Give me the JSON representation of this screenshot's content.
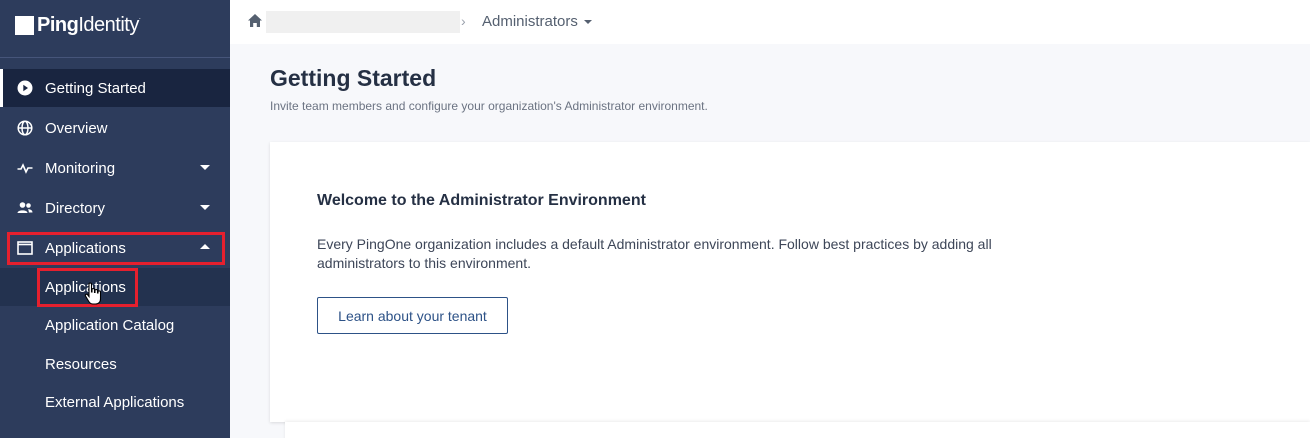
{
  "brand": {
    "logo_bold": "Ping",
    "logo_light": "Identity"
  },
  "sidebar": {
    "items": [
      {
        "label": "Getting Started",
        "icon": "play-circle-icon"
      },
      {
        "label": "Overview",
        "icon": "globe-icon"
      },
      {
        "label": "Monitoring",
        "icon": "pulse-icon"
      },
      {
        "label": "Directory",
        "icon": "users-icon"
      },
      {
        "label": "Applications",
        "icon": "window-icon"
      }
    ],
    "sub_items": [
      {
        "label": "Applications"
      },
      {
        "label": "Application Catalog"
      },
      {
        "label": "Resources"
      },
      {
        "label": "External Applications"
      }
    ]
  },
  "breadcrumb": {
    "separator": "›",
    "environment": "Administrators"
  },
  "main": {
    "title": "Getting Started",
    "subtitle": "Invite team members and configure your organization's Administrator environment.",
    "card": {
      "title": "Welcome to the Administrator Environment",
      "body": "Every PingOne organization includes a default Administrator environment. Follow best practices by adding all administrators to this environment.",
      "button": "Learn about your tenant"
    }
  },
  "colors": {
    "sidebar_bg": "#2d3c5c",
    "active_bg": "#192540",
    "highlight": "#e5202e",
    "accent": "#2d5287"
  }
}
